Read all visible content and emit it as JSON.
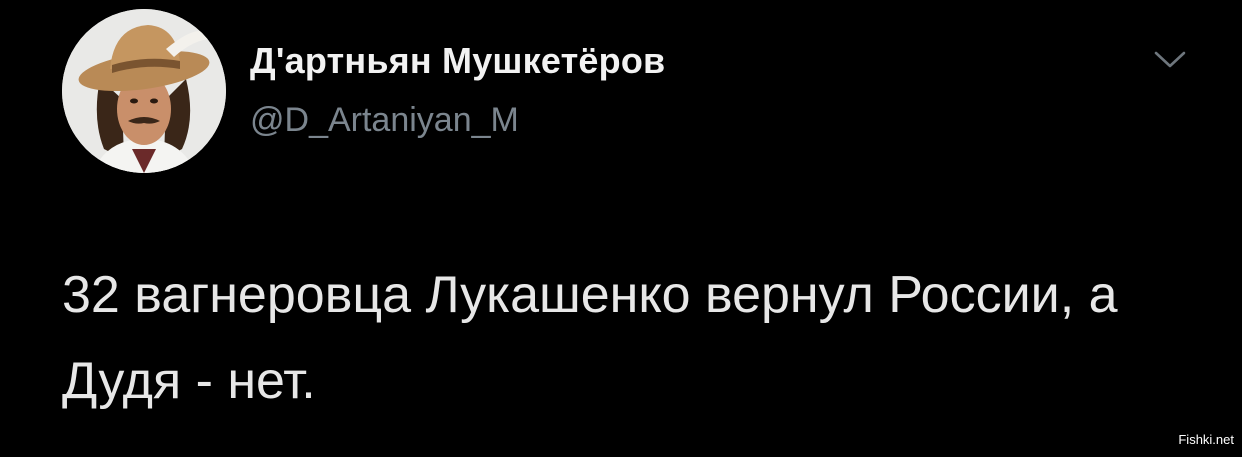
{
  "tweet": {
    "author": {
      "display_name": "Д'артньян Мушкетёров",
      "handle": "@D_Artaniyan_M",
      "avatar_icon": "profile-photo-musketeer"
    },
    "menu_icon": "chevron-down-icon",
    "text": "32 вагнеровца Лукашенко вернул России, а Дудя - нет."
  },
  "watermark": "Fishki.net",
  "colors": {
    "background": "#000000",
    "name": "#f2f2f2",
    "handle": "#7b858e",
    "text": "#e7e7e7"
  }
}
